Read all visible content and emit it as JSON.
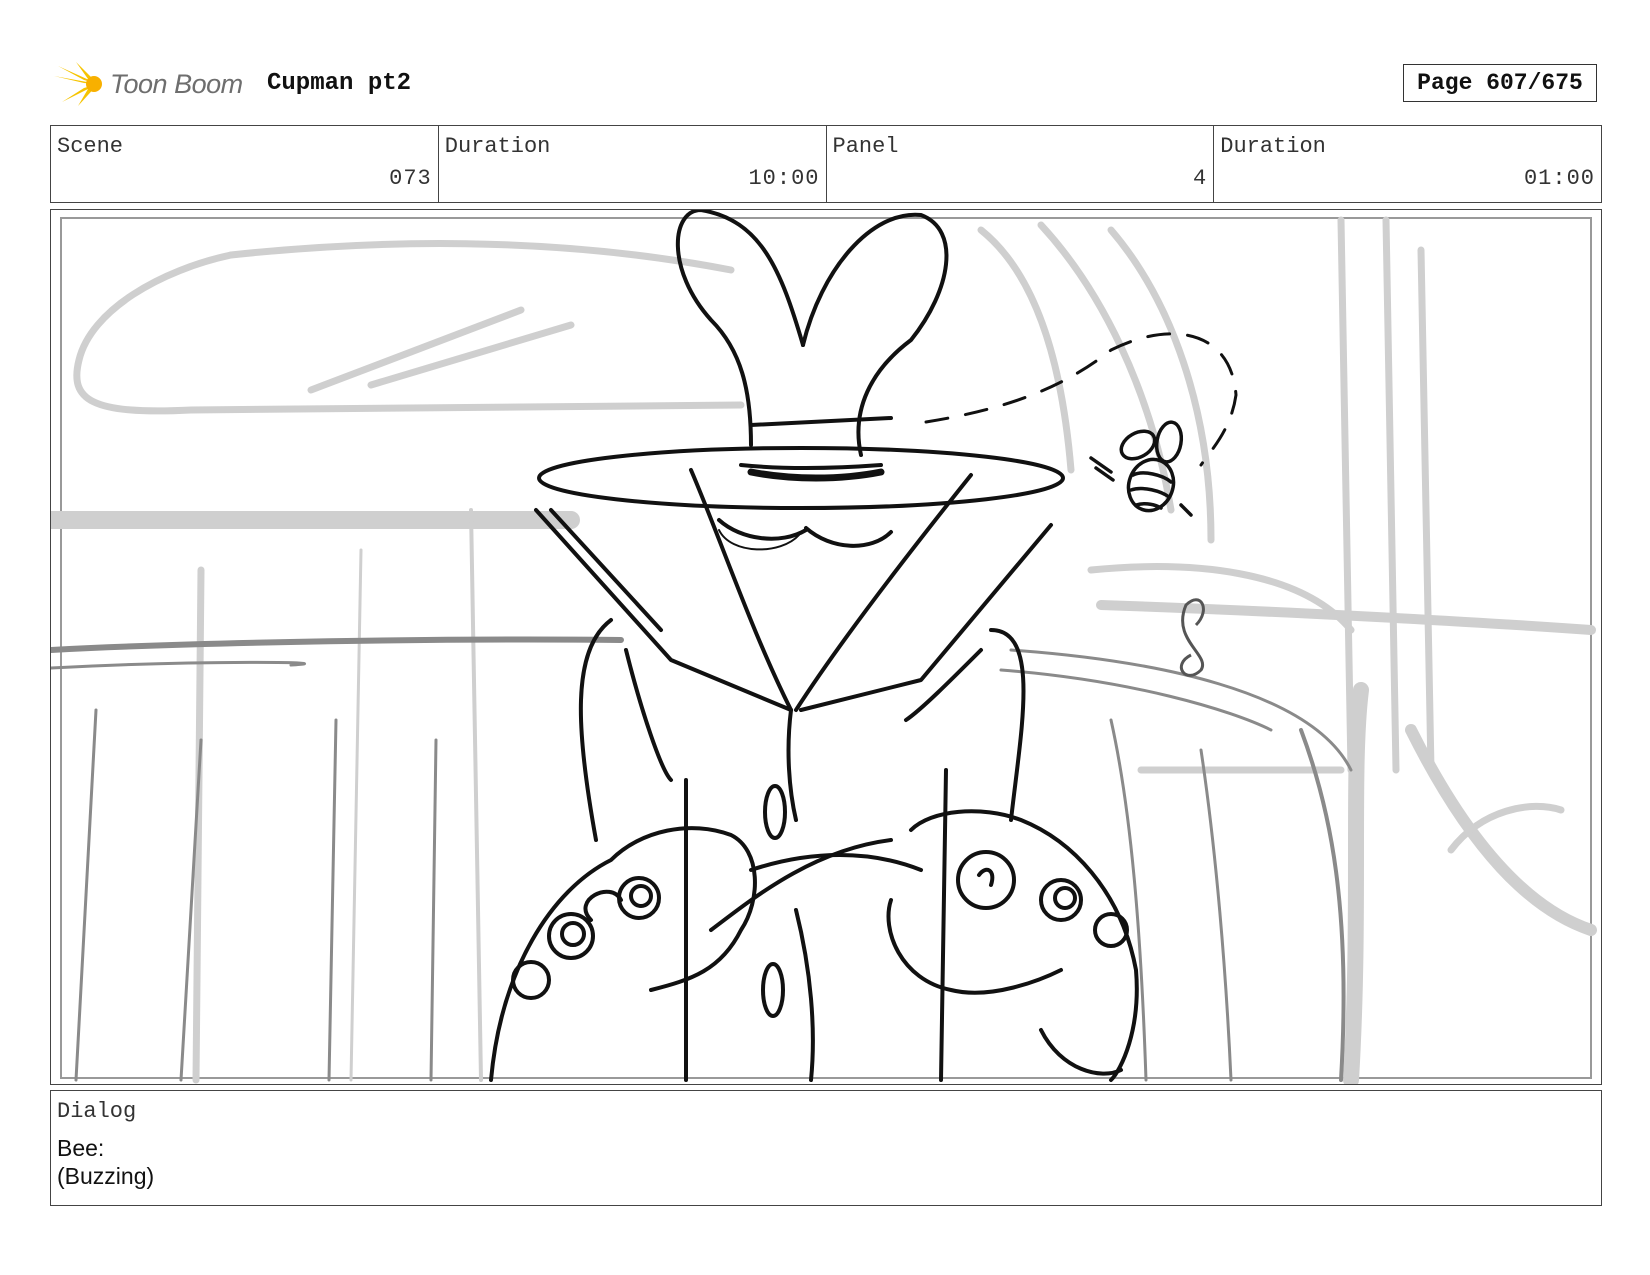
{
  "header": {
    "logo_text": "Toon Boom",
    "project_title": "Cupman pt2",
    "page_label": "Page 607/675"
  },
  "info": {
    "scene_label": "Scene",
    "scene_value": "073",
    "scene_duration_label": "Duration",
    "scene_duration_value": "10:00",
    "panel_label": "Panel",
    "panel_value": "4",
    "panel_duration_label": "Duration",
    "panel_duration_value": "01:00"
  },
  "dialog": {
    "label": "Dialog",
    "lines": [
      "Bee:",
      "(Buzzing)"
    ]
  },
  "colors": {
    "sketch_line": "#111111",
    "background_sketch": "#cfcfcf",
    "logo_accent": "#f6c400"
  },
  "icons": {
    "logo": "starburst-logo-icon"
  }
}
